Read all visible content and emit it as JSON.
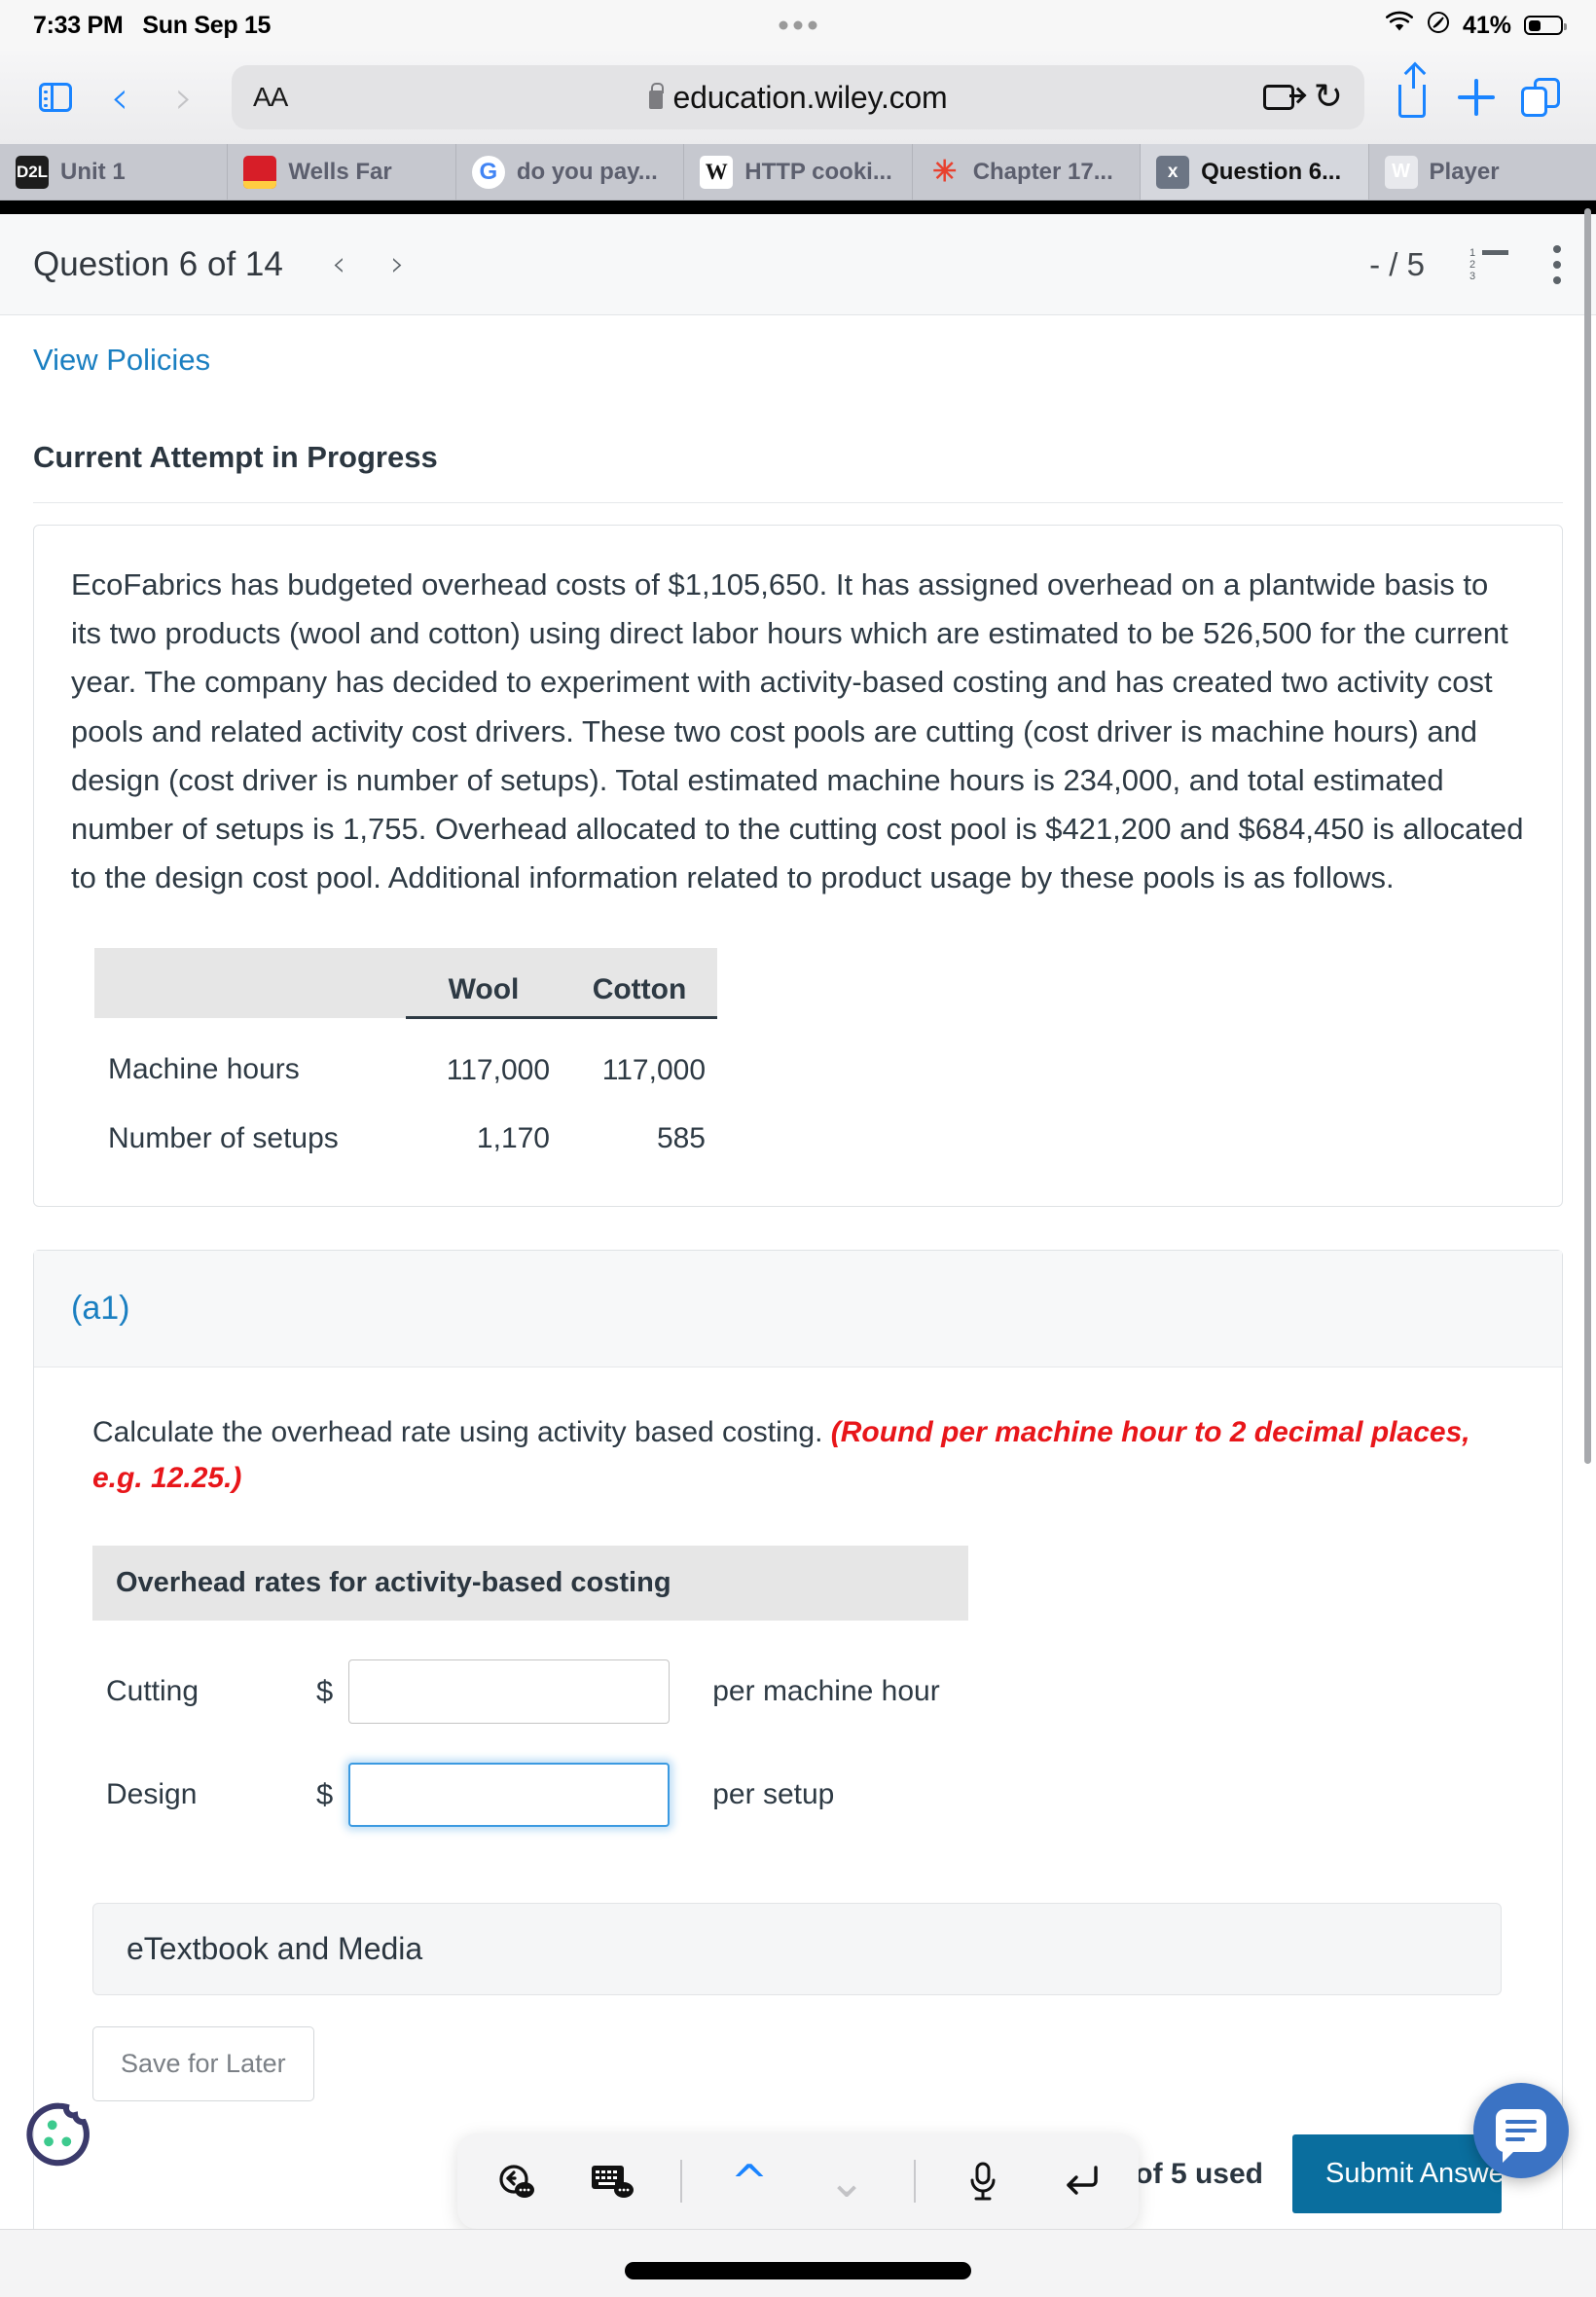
{
  "status_bar": {
    "time": "7:33 PM",
    "date": "Sun Sep 15",
    "battery_percent": "41%",
    "wifi_icon": "wifi-icon",
    "location_icon": "location-icon",
    "battery_icon": "battery-icon"
  },
  "browser": {
    "sidebar_icon": "sidebar-icon",
    "back_icon": "chevron-left-icon",
    "forward_icon": "chevron-right-icon",
    "text_size_label": "AA",
    "lock_icon": "lock-icon",
    "url": "education.wiley.com",
    "reader_icon": "reader-view-icon",
    "reload_icon": "reload-icon",
    "share_icon": "share-icon",
    "new_tab_icon": "plus-icon",
    "tabs_icon": "tab-overview-icon"
  },
  "tabs": [
    {
      "label": "Unit 1",
      "favicon": "d2l-favicon",
      "favicon_text": "D2L",
      "active": false
    },
    {
      "label": "Wells Far",
      "favicon": "wellsfargo-favicon",
      "favicon_text": "",
      "active": false
    },
    {
      "label": "do you pay...",
      "favicon": "google-favicon",
      "favicon_text": "G",
      "active": false
    },
    {
      "label": "HTTP cooki...",
      "favicon": "wikipedia-favicon",
      "favicon_text": "W",
      "active": false
    },
    {
      "label": "Chapter 17...",
      "favicon": "chegg-favicon",
      "favicon_text": "✳",
      "active": false
    },
    {
      "label": "Question 6...",
      "favicon": "excel-favicon",
      "favicon_text": "x",
      "active": true
    },
    {
      "label": "Player",
      "favicon": "wiley-favicon",
      "favicon_text": "W",
      "active": false
    }
  ],
  "question_header": {
    "title": "Question 6 of 14",
    "prev_icon": "chevron-left-icon",
    "next_icon": "chevron-right-icon",
    "score": "- / 5",
    "list_icon": "numbered-list-icon",
    "menu_icon": "kebab-menu-icon"
  },
  "page": {
    "view_policies": "View Policies",
    "current_attempt": "Current Attempt in Progress",
    "problem_text": "EcoFabrics has budgeted overhead costs of $1,105,650. It has assigned overhead on a plantwide basis to its two products (wool and cotton) using direct labor hours which are estimated to be 526,500 for the current year. The company has decided to experiment with activity-based costing and has created two activity cost pools and related activity cost drivers. These two cost pools are cutting (cost driver is machine hours) and design (cost driver is number of setups). Total estimated machine hours is 234,000, and total estimated number of setups is 1,755. Overhead allocated to the cutting cost pool is $421,200 and $684,450 is allocated to the design cost pool. Additional information related to product usage by these pools is as follows."
  },
  "data_table": {
    "columns": [
      "",
      "Wool",
      "Cotton"
    ],
    "rows": [
      {
        "label": "Machine hours",
        "wool": "117,000",
        "cotton": "117,000"
      },
      {
        "label": "Number of setups",
        "wool": "1,170",
        "cotton": "585"
      }
    ]
  },
  "part_a1": {
    "label": "(a1)",
    "instruction_plain": "Calculate the overhead rate using activity based costing. ",
    "instruction_emphasis": "(Round per machine hour to 2 decimal places, e.g. 12.25.)",
    "rates_table_title": "Overhead rates for activity-based costing",
    "rows": [
      {
        "label": "Cutting",
        "currency": "$",
        "value": "",
        "placeholder": "",
        "suffix": "per machine hour",
        "focused": false
      },
      {
        "label": "Design",
        "currency": "$",
        "value": "",
        "placeholder": "",
        "suffix": "per setup",
        "focused": true
      }
    ]
  },
  "actions": {
    "etextbook": "eTextbook and Media",
    "save_for_later": "Save for Later",
    "attempts": "Attempts: 0 of 5 used",
    "submit": "Submit Answer",
    "chat_icon": "chat-bubble-icon",
    "cookie_icon": "cookie-consent-icon"
  },
  "keyboard_bar": {
    "undo_icon": "undo-suggestion-icon",
    "keyboard_icon": "keyboard-suggestion-icon",
    "up_icon": "chevron-up-icon",
    "down_icon": "chevron-down-icon",
    "mic_icon": "microphone-icon",
    "return_icon": "return-icon"
  },
  "colors": {
    "accent_blue": "#1a7fc1",
    "submit_blue": "#0a6e9e",
    "emphasis_red": "#e8161a",
    "ios_blue": "#1a84ff"
  }
}
